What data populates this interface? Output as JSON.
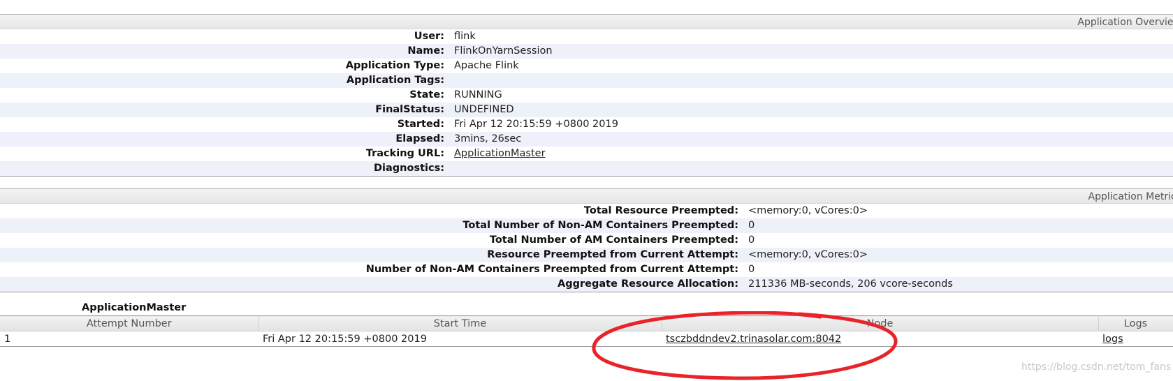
{
  "overview": {
    "header": "Application Overview",
    "rows": [
      {
        "label": "User:",
        "value": "flink"
      },
      {
        "label": "Name:",
        "value": "FlinkOnYarnSession"
      },
      {
        "label": "Application Type:",
        "value": "Apache Flink"
      },
      {
        "label": "Application Tags:",
        "value": ""
      },
      {
        "label": "State:",
        "value": "RUNNING"
      },
      {
        "label": "FinalStatus:",
        "value": "UNDEFINED"
      },
      {
        "label": "Started:",
        "value": "Fri Apr 12 20:15:59 +0800 2019"
      },
      {
        "label": "Elapsed:",
        "value": "3mins, 26sec"
      },
      {
        "label": "Tracking URL:",
        "value": "ApplicationMaster"
      },
      {
        "label": "Diagnostics:",
        "value": ""
      }
    ]
  },
  "metrics": {
    "header": "Application Metrics",
    "rows": [
      {
        "label": "Total Resource Preempted:",
        "value": "<memory:0, vCores:0>"
      },
      {
        "label": "Total Number of Non-AM Containers Preempted:",
        "value": "0"
      },
      {
        "label": "Total Number of AM Containers Preempted:",
        "value": "0"
      },
      {
        "label": "Resource Preempted from Current Attempt:",
        "value": "<memory:0, vCores:0>"
      },
      {
        "label": "Number of Non-AM Containers Preempted from Current Attempt:",
        "value": "0"
      },
      {
        "label": "Aggregate Resource Allocation:",
        "value": "211336 MB-seconds, 206 vcore-seconds"
      }
    ]
  },
  "attempts": {
    "caption": "ApplicationMaster",
    "columns": [
      "Attempt Number",
      "Start Time",
      "Node",
      "Logs"
    ],
    "rows": [
      {
        "attempt": "1",
        "start": "Fri Apr 12 20:15:59 +0800 2019",
        "node": "tsczbddndev2.trinasolar.com:8042",
        "logs": "logs"
      }
    ]
  },
  "annotation": {
    "color": "#e8232a"
  },
  "watermark": "https://blog.csdn.net/tom_fans"
}
